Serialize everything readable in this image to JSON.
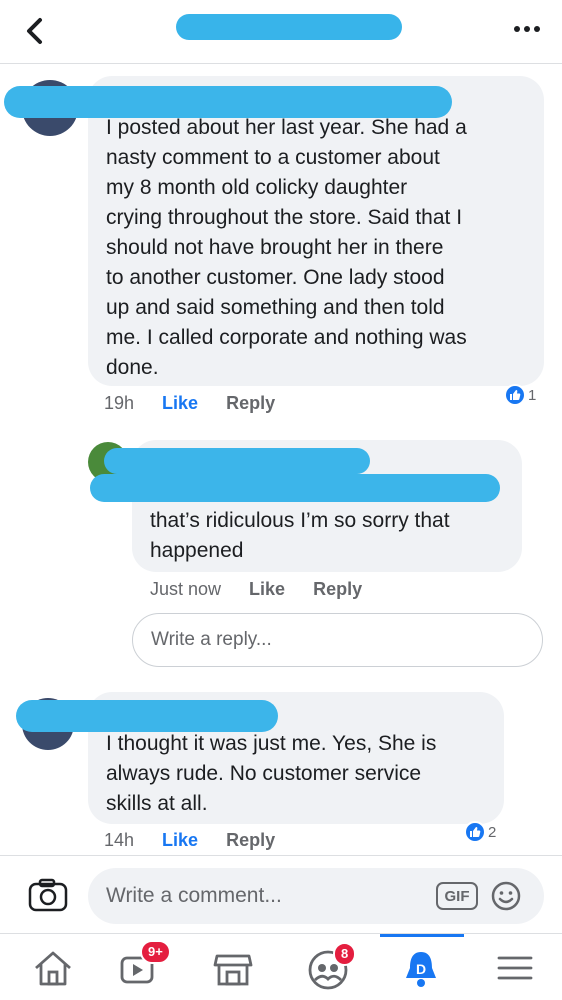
{
  "comments": [
    {
      "text": "I posted about her last year. She had a\nnasty comment to a customer about\nmy 8 month old colicky daughter\ncrying throughout the store. Said that I\nshould not have brought her in there\nto another customer. One lady stood\nup and said something and then told\nme. I called corporate and nothing was\ndone.",
      "time": "19h",
      "like": "Like",
      "reply": "Reply",
      "reaction_count": "1"
    },
    {
      "text": "that’s ridiculous I’m so sorry that\nhappened",
      "time": "Just now",
      "like": "Like",
      "reply": "Reply"
    },
    {
      "text": "I thought it was just me. Yes, She is\nalways rude. No customer service\nskills at all.",
      "time": "14h",
      "like": "Like",
      "reply": "Reply",
      "reaction_count": "2"
    }
  ],
  "reply_input": {
    "placeholder": "Write a reply..."
  },
  "composer": {
    "placeholder": "Write a comment...",
    "gif_label": "GIF"
  },
  "bottom_nav": {
    "video_badge": "9+",
    "groups_badge": "8"
  },
  "colors": {
    "accent": "#1877f2",
    "redaction": "#3cb5ea",
    "bubble": "#f0f2f5",
    "badge": "#e41e3f"
  }
}
